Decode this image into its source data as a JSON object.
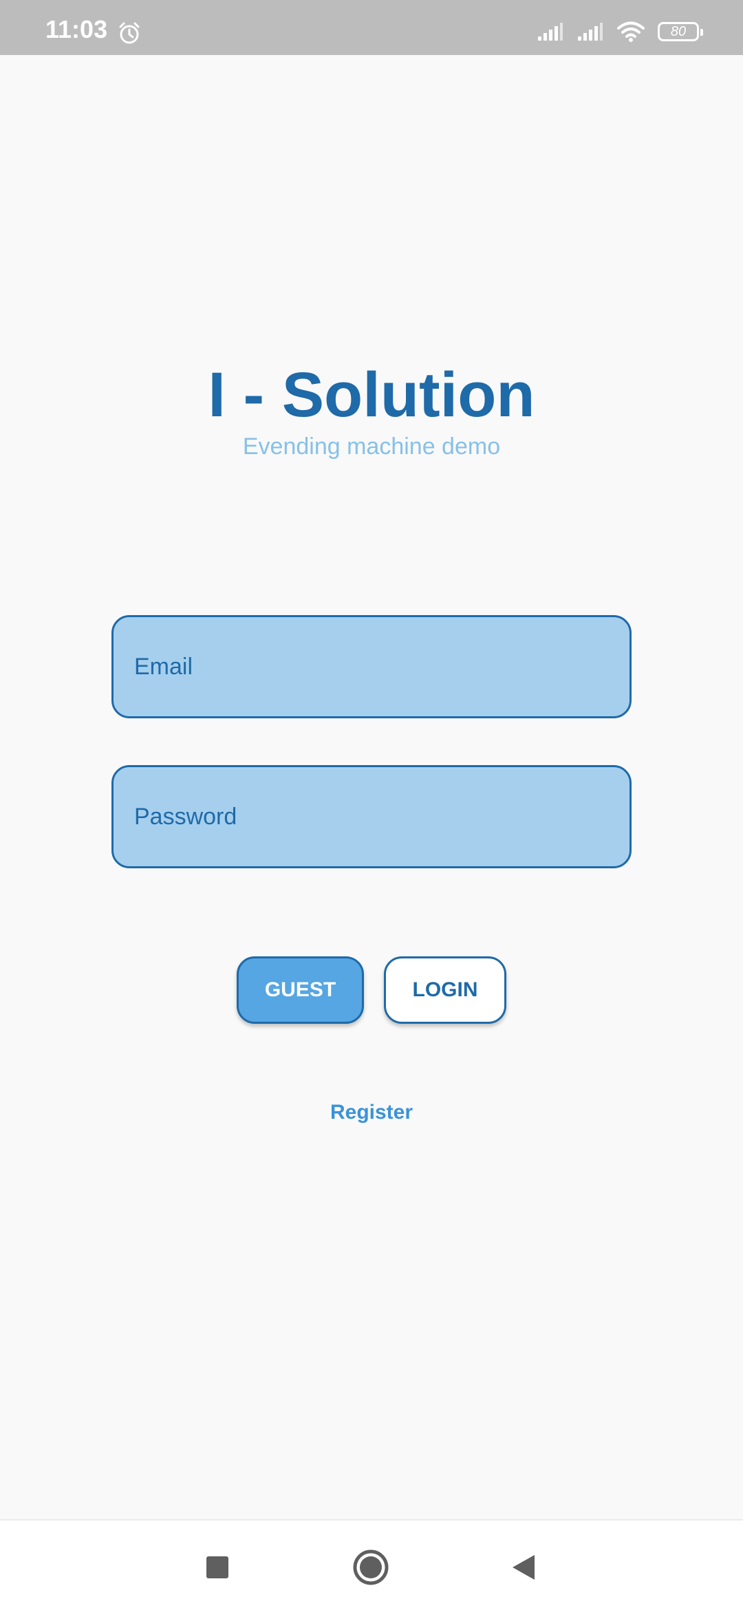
{
  "status_bar": {
    "time": "11:03",
    "battery_level": "80",
    "icons": [
      "alarm-icon",
      "signal-icon",
      "signal-icon",
      "wifi-icon",
      "battery-icon"
    ]
  },
  "header": {
    "title": "I - Solution",
    "subtitle": "Evending machine demo"
  },
  "form": {
    "email_placeholder": "Email",
    "email_value": "",
    "password_placeholder": "Password",
    "password_value": ""
  },
  "actions": {
    "guest_label": "GUEST",
    "login_label": "LOGIN",
    "register_label": "Register"
  },
  "nav_bar": {
    "icons": [
      "recent-apps-icon",
      "home-icon",
      "back-icon"
    ]
  },
  "colors": {
    "primary": "#1f6aa8",
    "accent": "#55a6e2",
    "field_fill": "#a6cfee",
    "subtitle": "#86c1e8",
    "link": "#3a93d8",
    "background": "#f9f9f9",
    "status_bar": "#bcbcbc"
  }
}
